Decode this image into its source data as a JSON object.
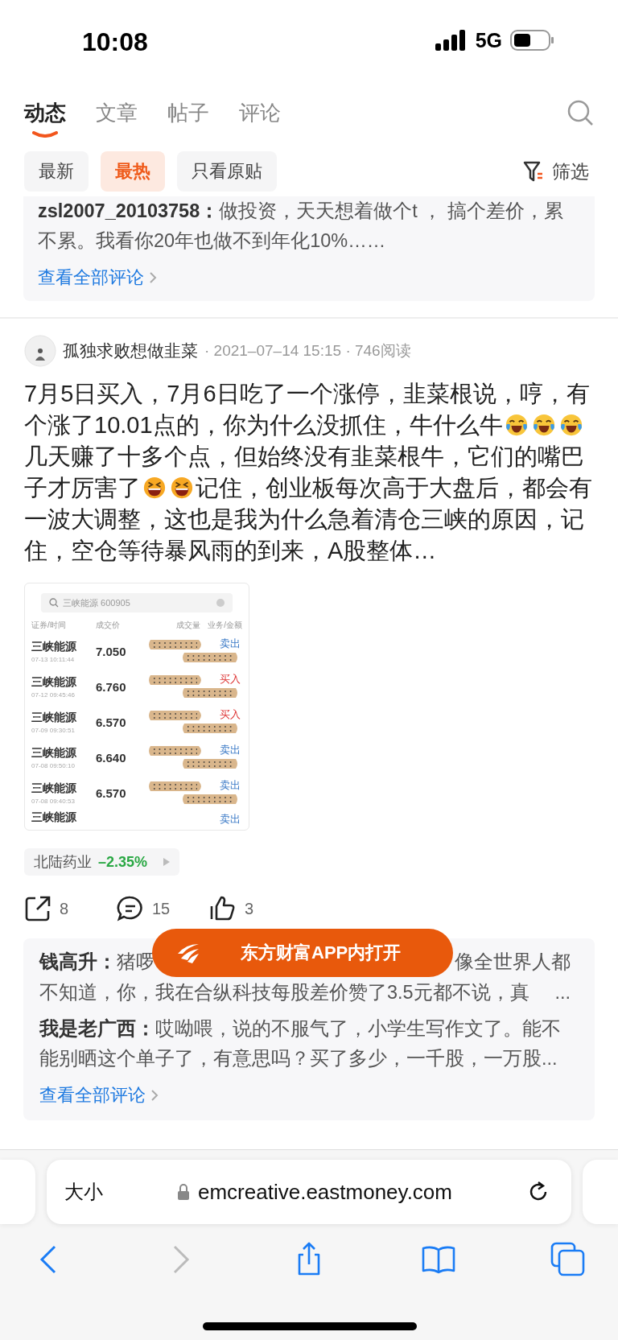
{
  "status_bar": {
    "time": "10:08",
    "network": "5G"
  },
  "tabs": [
    {
      "label": "动态",
      "selected": true
    },
    {
      "label": "文章",
      "selected": false
    },
    {
      "label": "帖子",
      "selected": false
    },
    {
      "label": "评论",
      "selected": false
    }
  ],
  "filters": [
    {
      "label": "最新",
      "selected": false
    },
    {
      "label": "最热",
      "selected": true
    },
    {
      "label": "只看原贴",
      "selected": false
    }
  ],
  "filter_button": "筛选",
  "top_comments": {
    "comments": [
      {
        "author": "zsl2007_20103758：",
        "text": "做投资，天天想着做个t ， 搞个差价，累不累。我看你20年也做不到年化10%……"
      }
    ],
    "more_link": "查看全部评论"
  },
  "post": {
    "author": "孤独求败想做韭菜",
    "meta": "· 2021–07–14 15:15 · 746阅读",
    "body": [
      {
        "kind": "text",
        "text": "7月5日买入，7月6日吃了一个涨停，韭菜根说，哼，有个涨了10.01点的，你为什么没抓住，牛什么牛"
      },
      {
        "kind": "laugh_cry"
      },
      {
        "kind": "laugh_cry"
      },
      {
        "kind": "laugh_cry"
      },
      {
        "kind": "text",
        "text": "几天赚了十多个点，但始终没有韭菜根牛，它们的嘴巴子才厉害了"
      },
      {
        "kind": "laugh"
      },
      {
        "kind": "laugh"
      },
      {
        "kind": "text",
        "text": "记住，创业板每次高于大盘后，都会有一波大调整，这也是我为什么急着清仓三峡的原因，记住，空仓等待暴风雨的到来，A股整体…"
      }
    ],
    "screenshot": {
      "search": "三峡能源  600905",
      "columns": [
        "证券/时间",
        "成交价",
        "成交量",
        "业务/金额"
      ],
      "rows": [
        {
          "name": "三峡能源",
          "time": "07-13 10:11:44",
          "price": "7.050",
          "action": "卖出",
          "kind": "sell"
        },
        {
          "name": "三峡能源",
          "time": "07-12 09:45:46",
          "price": "6.760",
          "action": "买入",
          "kind": "buy"
        },
        {
          "name": "三峡能源",
          "time": "07-09 09:30:51",
          "price": "6.570",
          "action": "买入",
          "kind": "buy"
        },
        {
          "name": "三峡能源",
          "time": "07-08 09:50:10",
          "price": "6.640",
          "action": "卖出",
          "kind": "sell"
        },
        {
          "name": "三峡能源",
          "time": "07-08 09:40:53",
          "price": "6.570",
          "action": "卖出",
          "kind": "sell"
        },
        {
          "name": "三峡能源",
          "action": "卖出",
          "kind": "sell"
        }
      ]
    },
    "stock_tag": {
      "name": "北陆药业",
      "change": "–2.35%"
    },
    "actions": [
      {
        "kind": "share",
        "count": "8"
      },
      {
        "kind": "comment",
        "count": "15"
      },
      {
        "kind": "like",
        "count": "3"
      }
    ],
    "comments": [
      {
        "author": "钱高升：",
        "text_parts": [
          "猪啰",
          "像全世界人都"
        ],
        "line2": "不知道，你，我在合纵科技每股差价赞了3.5元都不说，真",
        "ellipsis": "..."
      },
      {
        "author": "我是老广西：",
        "text": "哎呦喂，说的不服气了，小学生写作文了。能不能别晒这个单子了，有意思吗？买了多少，一千股，一万股",
        "ellipsis": "..."
      }
    ],
    "more_link": "查看全部评论"
  },
  "open_app_button": "东方财富APP内打开",
  "browser": {
    "text_size": "大小",
    "url": "emcreative.eastmoney.com"
  }
}
